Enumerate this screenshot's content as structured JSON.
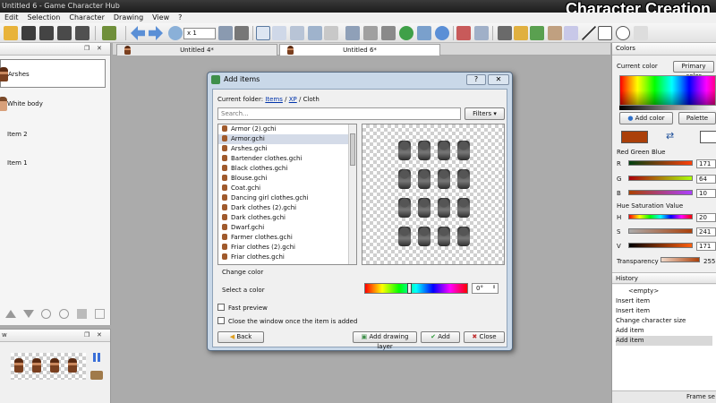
{
  "window": {
    "title": "Untitled 6 - Game Character Hub",
    "overlay_title": "Character Creation"
  },
  "menu": [
    "Edit",
    "Selection",
    "Character",
    "Drawing",
    "View",
    "?"
  ],
  "toolbar": {
    "zoom": "x 1"
  },
  "layers": {
    "items": [
      {
        "label": "Arshes"
      },
      {
        "label": "White body"
      },
      {
        "label": "Item 2"
      },
      {
        "label": "Item 1"
      }
    ]
  },
  "tabs": [
    {
      "label": "Untitled 4*"
    },
    {
      "label": "Untitled 6*"
    }
  ],
  "dialog": {
    "title": "Add items",
    "folder_label": "Current folder:",
    "breadcrumb": [
      "Items",
      "XP",
      "Cloth"
    ],
    "search_placeholder": "Search...",
    "filters_label": "Filters",
    "files": [
      "Armor (2).gchi",
      "Armor.gchi",
      "Arshes.gchi",
      "Bartender clothes.gchi",
      "Black clothes.gchi",
      "Blouse.gchi",
      "Coat.gchi",
      "Dancing girl clothes.gchi",
      "Dark clothes (2).gchi",
      "Dark clothes.gchi",
      "Dwarf.gchi",
      "Farmer clothes.gchi",
      "Friar clothes (2).gchi",
      "Friar clothes.gchi"
    ],
    "selected_index": 1,
    "change_color_label": "Change color",
    "select_color_label": "Select a color",
    "hue_value": "0°",
    "hue_level": 0.42,
    "fast_preview_label": "Fast preview",
    "close_window_label": "Close the window once the item is added",
    "back_label": "Back",
    "add_drawing_layer_label": "Add drawing layer",
    "add_label": "Add",
    "close_label": "Close"
  },
  "colors": {
    "panel_title": "Colors",
    "current_color_label": "Current color",
    "primary_color_label": "Primary color",
    "add_color_label": "Add color",
    "palette_label": "Palette",
    "current_color_hex": "#ab400a",
    "rgb_label": "Red Green Blue",
    "r_label": "R",
    "r_value": "171",
    "g_label": "G",
    "g_value": "64",
    "b_label": "B",
    "b_value": "10",
    "hsv_label": "Hue Saturation Value",
    "h_label": "H",
    "h_value": "20",
    "s_label": "S",
    "s_value": "241",
    "v_label": "V",
    "v_value": "171",
    "transparency_label": "Transparency",
    "transparency_value": "255"
  },
  "history": {
    "panel_title": "History",
    "items": [
      "<empty>",
      "Insert item",
      "Insert item",
      "Change character size",
      "Add item",
      "Add item"
    ],
    "selected_index": 5
  },
  "status": {
    "text": "Frame se"
  }
}
